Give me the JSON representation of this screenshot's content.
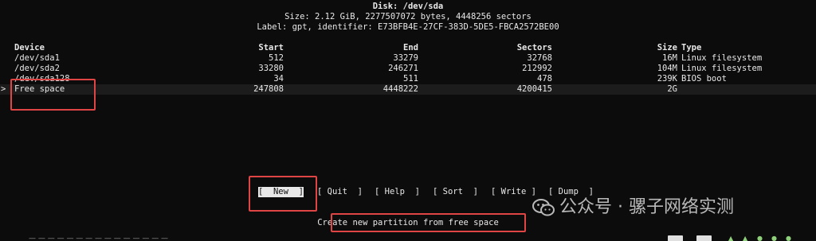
{
  "header": {
    "disk": "Disk: /dev/sda",
    "size": "Size: 2.12 GiB, 2277507072 bytes, 4448256 sectors",
    "label": "Label: gpt, identifier: E73BFB4E-27CF-383D-5DE5-FBCA2572BE00"
  },
  "table": {
    "columns": [
      "Device",
      "Start",
      "End",
      "Sectors",
      "Size",
      "Type"
    ],
    "rows": [
      {
        "device": "/dev/sda1",
        "start": "512",
        "end": "33279",
        "sectors": "32768",
        "size": "16M",
        "type": "Linux filesystem"
      },
      {
        "device": "/dev/sda2",
        "start": "33280",
        "end": "246271",
        "sectors": "212992",
        "size": "104M",
        "type": "Linux filesystem"
      },
      {
        "device": "/dev/sda128",
        "start": "34",
        "end": "511",
        "sectors": "478",
        "size": "239K",
        "type": "BIOS boot"
      },
      {
        "device": "Free space",
        "start": "247808",
        "end": "4448222",
        "sectors": "4200415",
        "size": "2G",
        "type": "",
        "marker": ">"
      }
    ]
  },
  "menu": [
    {
      "label": "New"
    },
    {
      "label": "Quit"
    },
    {
      "label": "Help"
    },
    {
      "label": "Sort"
    },
    {
      "label": "Write"
    },
    {
      "label": "Dump"
    }
  ],
  "hint": "Create new partition from free space",
  "watermark": "公众号 · 骡子网络实测",
  "colors": {
    "background": "#0c0c0c",
    "text": "#e8e8e8",
    "annotation": "#e04545",
    "selected_bg": "#e8e8e8"
  }
}
